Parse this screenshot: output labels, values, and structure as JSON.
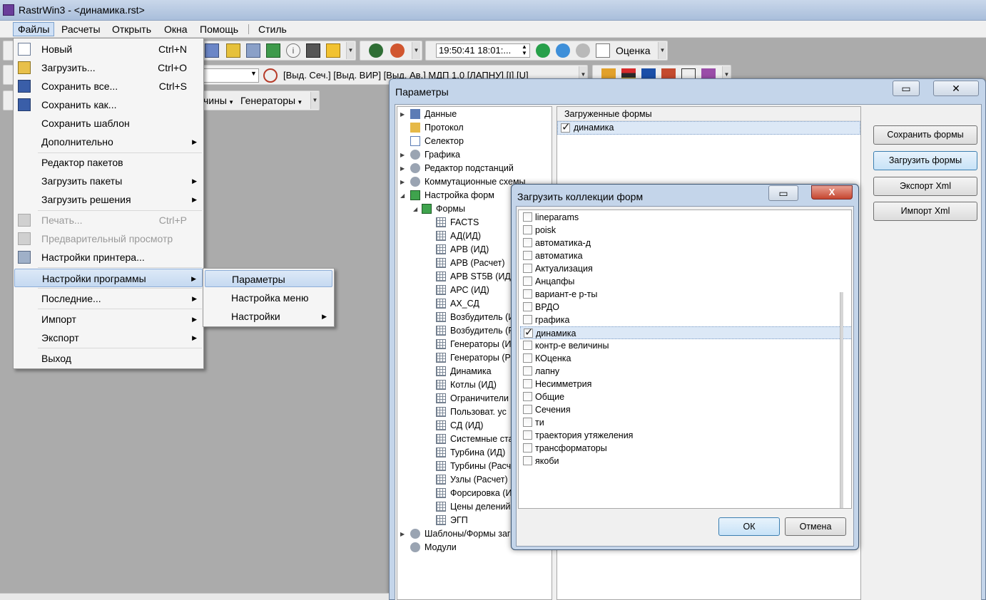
{
  "window": {
    "title": "RastrWin3 - <динамика.rst>"
  },
  "menubar": {
    "items": [
      "Файлы",
      "Расчеты",
      "Открыть",
      "Окна",
      "Помощь",
      "Стиль"
    ]
  },
  "toolbar": {
    "clock": "19:50:41  18:01:...",
    "ocenka_label": "Оценка",
    "selection_text": "[Выд. Сеч.]  [Выд. ВИР]  [Выд. Ав.]  МДП 1.0  [ЛАПНУ]  [I]  [U]",
    "row3_items": [
      "чины",
      "Генераторы"
    ]
  },
  "file_menu": {
    "items": [
      {
        "label": "Новый",
        "shortcut": "Ctrl+N",
        "icon": "new-file-icon"
      },
      {
        "label": "Загрузить...",
        "shortcut": "Ctrl+O",
        "icon": "open-folder-icon"
      },
      {
        "label": "Сохранить все...",
        "shortcut": "Ctrl+S",
        "icon": "save-all-icon"
      },
      {
        "label": "Сохранить как...",
        "shortcut": "",
        "icon": "save-as-icon"
      },
      {
        "label": "Сохранить шаблон",
        "shortcut": ""
      },
      {
        "label": "Дополнительно",
        "submenu": true
      },
      {
        "label": "Редактор пакетов"
      },
      {
        "label": "Загрузить пакеты",
        "submenu": true
      },
      {
        "label": "Загрузить решения",
        "submenu": true
      },
      {
        "label": "Печать...",
        "shortcut": "Ctrl+P",
        "disabled": true,
        "icon": "print-icon"
      },
      {
        "label": "Предварительный просмотр",
        "disabled": true,
        "icon": "print-preview-icon"
      },
      {
        "label": "Настройки принтера...",
        "icon": "printer-settings-icon"
      },
      {
        "label": "Настройки программы",
        "submenu": true,
        "highlight": true
      },
      {
        "label": "Последние...",
        "submenu": true
      },
      {
        "label": "Импорт",
        "submenu": true
      },
      {
        "label": "Экспорт",
        "submenu": true
      },
      {
        "label": "Выход"
      }
    ]
  },
  "submenu": {
    "items": [
      "Параметры",
      "Настройка меню",
      "Настройки"
    ]
  },
  "params_window": {
    "title": "Параметры",
    "tree": {
      "roots": [
        "Данные",
        "Протокол",
        "Селектор",
        "Графика",
        "Редактор подстанций",
        "Коммутационные схемы",
        "Настройка форм"
      ],
      "forms_node": "Формы",
      "forms": [
        "FACTS",
        "АД(ИД)",
        "АРВ (ИД)",
        "АРВ (Расчет)",
        "АРВ ST5B (ИД)",
        "АРС  (ИД)",
        "АХ_СД",
        "Возбудитель (И",
        "Возбудитель (Р",
        "Генераторы (И",
        "Генераторы (Р",
        "Динамика",
        "Котлы (ИД)",
        "Ограничители",
        "Пользоват. ус",
        "СД (ИД)",
        "Системные ста",
        "Турбина (ИД)",
        "Турбины (Расч",
        "Узлы (Расчет)",
        "Форсировка (И",
        "Цены делений",
        "ЭГП"
      ],
      "bottom": [
        "Шаблоны/Формы заг",
        "Модули"
      ]
    },
    "loaded_header": "Загруженные формы",
    "loaded_forms": [
      "динамика"
    ],
    "buttons": [
      "Сохранить формы",
      "Загрузить формы",
      "Экспорт Xml",
      "Импорт Xml"
    ]
  },
  "load_dialog": {
    "title": "Загрузить коллекции форм",
    "close_label": "X",
    "items": [
      {
        "label": "lineparams",
        "checked": false
      },
      {
        "label": "poisk",
        "checked": false
      },
      {
        "label": "автоматика-д",
        "checked": false
      },
      {
        "label": "автоматика",
        "checked": false
      },
      {
        "label": "Актуализация",
        "checked": false
      },
      {
        "label": "Анцапфы",
        "checked": false
      },
      {
        "label": "вариант-е р-ты",
        "checked": false
      },
      {
        "label": "ВРДО",
        "checked": false
      },
      {
        "label": "графика",
        "checked": false
      },
      {
        "label": "динамика",
        "checked": true
      },
      {
        "label": "контр-е величины",
        "checked": false
      },
      {
        "label": "КОценка",
        "checked": false
      },
      {
        "label": "лапну",
        "checked": false
      },
      {
        "label": "Несимметрия",
        "checked": false
      },
      {
        "label": "Общие",
        "checked": false
      },
      {
        "label": "Сечения",
        "checked": false
      },
      {
        "label": "ти",
        "checked": false
      },
      {
        "label": "траектория утяжеления",
        "checked": false
      },
      {
        "label": "трансформаторы",
        "checked": false
      },
      {
        "label": "якоби",
        "checked": false
      }
    ],
    "ok_label": "ОК",
    "cancel_label": "Отмена"
  }
}
